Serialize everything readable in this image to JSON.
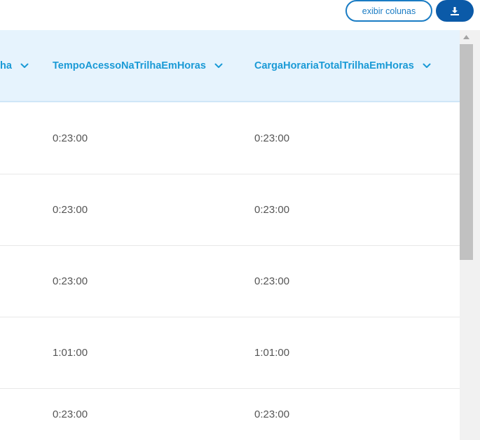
{
  "toolbar": {
    "show_columns_label": "exibir colunas",
    "download_icon": "download-icon"
  },
  "table": {
    "columns": [
      {
        "label": "ha"
      },
      {
        "label": "TempoAcessoNaTrilhaEmHoras"
      },
      {
        "label": "CargaHorariaTotalTrilhaEmHoras"
      }
    ],
    "rows": [
      {
        "tempo": "0:23:00",
        "carga": "0:23:00"
      },
      {
        "tempo": "0:23:00",
        "carga": "0:23:00"
      },
      {
        "tempo": "0:23:00",
        "carga": "0:23:00"
      },
      {
        "tempo": "1:01:00",
        "carga": "1:01:00"
      },
      {
        "tempo": "0:23:00",
        "carga": "0:23:00"
      }
    ]
  },
  "colors": {
    "accent": "#1a9ad6",
    "button_primary": "#0b5aa8",
    "header_bg": "#e6f3fd"
  }
}
